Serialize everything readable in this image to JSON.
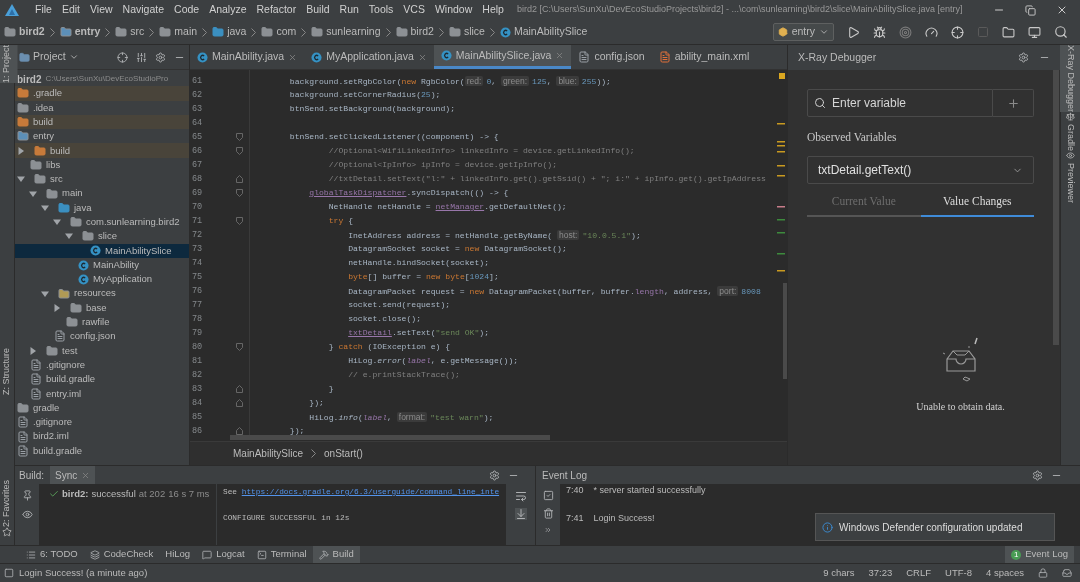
{
  "menu_bar": {
    "items": [
      "File",
      "Edit",
      "View",
      "Navigate",
      "Code",
      "Analyze",
      "Refactor",
      "Build",
      "Run",
      "Tools",
      "VCS",
      "Window",
      "Help"
    ],
    "title": "bird2 [C:\\Users\\SunXu\\DevEcoStudioProjects\\bird2] - ...\\com\\sunlearning\\bird2\\slice\\MainAbilitySlice.java [entry]"
  },
  "breadcrumbs": [
    {
      "label": "bird2",
      "kind": "project"
    },
    {
      "label": "entry",
      "kind": "module"
    },
    {
      "label": "src",
      "kind": "folder"
    },
    {
      "label": "main",
      "kind": "folder"
    },
    {
      "label": "java",
      "kind": "source"
    },
    {
      "label": "com",
      "kind": "folder"
    },
    {
      "label": "sunlearning",
      "kind": "folder"
    },
    {
      "label": "bird2",
      "kind": "folder"
    },
    {
      "label": "slice",
      "kind": "folder"
    },
    {
      "label": "MainAbilitySlice",
      "kind": "class"
    }
  ],
  "run_config": "entry",
  "left_strip": [
    {
      "label": "1: Project",
      "selected": true
    },
    {
      "label": "Z: Structure",
      "selected": false
    }
  ],
  "favorites_strip": {
    "label": "2: Favorites"
  },
  "right_strip": [
    {
      "label": "X-Ray Debugger",
      "selected": true
    },
    {
      "label": "Gradle",
      "selected": false
    },
    {
      "label": "Previewer",
      "selected": false
    }
  ],
  "project_panel": {
    "view": "Project",
    "root": {
      "name": "bird2",
      "path": "C:\\Users\\SunXu\\DevEcoStudioPro"
    },
    "tree": [
      {
        "name": ".gradle",
        "kind": "excluded",
        "selected": false
      },
      {
        "name": ".idea",
        "kind": "folder",
        "selected": false
      },
      {
        "name": "build",
        "kind": "excluded",
        "selected": false
      },
      {
        "name": "entry",
        "kind": "module",
        "selected": false,
        "children": [
          {
            "name": "build",
            "kind": "excluded",
            "expanded": false,
            "selected": false
          },
          {
            "name": "libs",
            "kind": "folder",
            "selected": false
          },
          {
            "name": "src",
            "kind": "folder",
            "expanded": true,
            "selected": false,
            "children": [
              {
                "name": "main",
                "kind": "folder",
                "expanded": true,
                "selected": false,
                "children": [
                  {
                    "name": "java",
                    "kind": "source",
                    "expanded": true,
                    "selected": false,
                    "children": [
                      {
                        "name": "com.sunlearning.bird2",
                        "kind": "package",
                        "expanded": true,
                        "selected": false,
                        "children": [
                          {
                            "name": "slice",
                            "kind": "package",
                            "expanded": true,
                            "selected": false,
                            "children": [
                              {
                                "name": "MainAbilitySlice",
                                "kind": "class",
                                "selected": true
                              }
                            ]
                          },
                          {
                            "name": "MainAbility",
                            "kind": "class",
                            "selected": false
                          },
                          {
                            "name": "MyApplication",
                            "kind": "class",
                            "selected": false
                          }
                        ]
                      }
                    ]
                  },
                  {
                    "name": "resources",
                    "kind": "resources",
                    "expanded": true,
                    "selected": false,
                    "children": [
                      {
                        "name": "base",
                        "kind": "package",
                        "expanded": false,
                        "selected": false
                      },
                      {
                        "name": "rawfile",
                        "kind": "package",
                        "selected": false
                      }
                    ]
                  },
                  {
                    "name": "config.json",
                    "kind": "file",
                    "selected": false
                  }
                ]
              },
              {
                "name": "test",
                "kind": "folder",
                "expanded": false,
                "selected": false
              }
            ]
          },
          {
            "name": ".gitignore",
            "kind": "file",
            "selected": false
          },
          {
            "name": "build.gradle",
            "kind": "file",
            "selected": false
          },
          {
            "name": "entry.iml",
            "kind": "file",
            "selected": false
          }
        ]
      },
      {
        "name": "gradle",
        "kind": "folder",
        "selected": false
      },
      {
        "name": ".gitignore",
        "kind": "file",
        "selected": false
      },
      {
        "name": "bird2.iml",
        "kind": "file",
        "selected": false
      },
      {
        "name": "build.gradle",
        "kind": "file",
        "selected": false
      }
    ]
  },
  "editor_tabs": [
    {
      "label": "MainAbility.java",
      "kind": "class",
      "selected": false,
      "closable": true
    },
    {
      "label": "MyApplication.java",
      "kind": "class",
      "selected": false,
      "closable": true
    },
    {
      "label": "MainAbilitySlice.java",
      "kind": "class",
      "selected": true,
      "closable": true
    },
    {
      "label": "config.json",
      "kind": "json",
      "selected": false,
      "closable": false
    },
    {
      "label": "ability_main.xml",
      "kind": "xml",
      "selected": false,
      "closable": false
    }
  ],
  "code": [
    {
      "number": "61",
      "kind": "plain",
      "segments": [
        {
          "text": "        background.setRgbColor(",
          "kind": "plain"
        },
        {
          "text": "new",
          "kind": "keyword"
        },
        {
          "text": " RgbColor(",
          "kind": "plain"
        },
        {
          "text": "red:",
          "kind": "hint"
        },
        {
          "text": "0",
          "kind": "number"
        },
        {
          "text": ", ",
          "kind": "plain"
        },
        {
          "text": "green:",
          "kind": "hint"
        },
        {
          "text": "125",
          "kind": "number"
        },
        {
          "text": ", ",
          "kind": "plain"
        },
        {
          "text": "blue:",
          "kind": "hint"
        },
        {
          "text": "255",
          "kind": "number"
        },
        {
          "text": "));",
          "kind": "plain"
        }
      ]
    },
    {
      "number": "62",
      "kind": "plain",
      "segments": [
        {
          "text": "        background.setCornerRadius(",
          "kind": "plain"
        },
        {
          "text": "25",
          "kind": "number"
        },
        {
          "text": ");",
          "kind": "plain"
        }
      ]
    },
    {
      "number": "63",
      "kind": "plain",
      "segments": [
        {
          "text": "        btnSend.setBackground(background);",
          "kind": "plain"
        }
      ]
    },
    {
      "number": "64",
      "kind": "plain"
    },
    {
      "number": "65",
      "kind": "fold-start",
      "segments": [
        {
          "text": "        btnSend.setClickedListener((component) -> {",
          "kind": "plain"
        }
      ]
    },
    {
      "number": "66",
      "kind": "fold-start",
      "segments": [
        {
          "text": "                //Optional<WifiLinkedInfo> linkedInfo = device.getLinkedInfo();",
          "kind": "comment"
        }
      ]
    },
    {
      "number": "67",
      "kind": "plain",
      "segments": [
        {
          "text": "                //Optional<IpInfo> ipInfo = device.getIpInfo();",
          "kind": "comment"
        }
      ]
    },
    {
      "number": "68",
      "kind": "fold-end",
      "segments": [
        {
          "text": "                //txtDetail.setText(\"l:\" + linkedInfo.get().getSsid() + \"; i:\" + ipInfo.get().getIpAddress",
          "kind": "comment"
        }
      ]
    },
    {
      "number": "69",
      "kind": "fold-start",
      "segments": [
        {
          "text": "            globalTaskDispatcher",
          "kind": "field"
        },
        {
          "text": ".syncDispatch(() -> {",
          "kind": "plain"
        }
      ]
    },
    {
      "number": "70",
      "kind": "plain",
      "segments": [
        {
          "text": "                NetHandle netHandle = ",
          "kind": "plain"
        },
        {
          "text": "netManager",
          "kind": "field"
        },
        {
          "text": ".getDefaultNet();",
          "kind": "plain"
        }
      ]
    },
    {
      "number": "71",
      "kind": "fold-start",
      "segments": [
        {
          "text": "                try",
          "kind": "keyword"
        },
        {
          "text": " {",
          "kind": "plain"
        }
      ]
    },
    {
      "number": "72",
      "kind": "plain",
      "segments": [
        {
          "text": "                    InetAddress address = netHandle.getByName( ",
          "kind": "plain"
        },
        {
          "text": "host:",
          "kind": "hint"
        },
        {
          "text": "\"10.0.5.1\"",
          "kind": "string"
        },
        {
          "text": ");",
          "kind": "plain"
        }
      ]
    },
    {
      "number": "73",
      "kind": "plain",
      "segments": [
        {
          "text": "                    DatagramSocket socket = ",
          "kind": "plain"
        },
        {
          "text": "new",
          "kind": "keyword"
        },
        {
          "text": " DatagramSocket();",
          "kind": "plain"
        }
      ]
    },
    {
      "number": "74",
      "kind": "plain",
      "segments": [
        {
          "text": "                    netHandle.bindSocket(socket);",
          "kind": "plain"
        }
      ]
    },
    {
      "number": "75",
      "kind": "plain",
      "segments": [
        {
          "text": "                    byte",
          "kind": "keyword"
        },
        {
          "text": "[] buffer = ",
          "kind": "plain"
        },
        {
          "text": "new byte",
          "kind": "keyword"
        },
        {
          "text": "[",
          "kind": "plain"
        },
        {
          "text": "1024",
          "kind": "number"
        },
        {
          "text": "];",
          "kind": "plain"
        }
      ]
    },
    {
      "number": "76",
      "kind": "plain",
      "segments": [
        {
          "text": "                    DatagramPacket request = ",
          "kind": "plain"
        },
        {
          "text": "new",
          "kind": "keyword"
        },
        {
          "text": " DatagramPacket(buffer, buffer.",
          "kind": "plain"
        },
        {
          "text": "length",
          "kind": "property"
        },
        {
          "text": ", address, ",
          "kind": "plain"
        },
        {
          "text": "port:",
          "kind": "hint"
        },
        {
          "text": "8008",
          "kind": "number"
        }
      ]
    },
    {
      "number": "77",
      "kind": "plain",
      "segments": [
        {
          "text": "                    socket.send(request);",
          "kind": "plain"
        }
      ]
    },
    {
      "number": "78",
      "kind": "plain",
      "segments": [
        {
          "text": "                    socket.close();",
          "kind": "plain"
        }
      ]
    },
    {
      "number": "79",
      "kind": "plain",
      "segments": [
        {
          "text": "                    txtDetail",
          "kind": "field"
        },
        {
          "text": ".setText(",
          "kind": "plain"
        },
        {
          "text": "\"send OK\"",
          "kind": "string"
        },
        {
          "text": ");",
          "kind": "plain"
        }
      ]
    },
    {
      "number": "80",
      "kind": "fold-start",
      "segments": [
        {
          "text": "                } ",
          "kind": "plain"
        },
        {
          "text": "catch",
          "kind": "keyword"
        },
        {
          "text": " (IOException e) {",
          "kind": "plain"
        }
      ]
    },
    {
      "number": "81",
      "kind": "plain",
      "segments": [
        {
          "text": "                    HiLog.",
          "kind": "plain"
        },
        {
          "text": "error",
          "kind": "italic"
        },
        {
          "text": "(",
          "kind": "plain"
        },
        {
          "text": "label",
          "kind": "italic-field"
        },
        {
          "text": ", e.getMessage());",
          "kind": "plain"
        }
      ]
    },
    {
      "number": "82",
      "kind": "plain",
      "segments": [
        {
          "text": "                    // e.printStackTrace();",
          "kind": "comment"
        }
      ]
    },
    {
      "number": "83",
      "kind": "fold-end",
      "segments": [
        {
          "text": "                }",
          "kind": "plain"
        }
      ]
    },
    {
      "number": "84",
      "kind": "fold-end",
      "segments": [
        {
          "text": "            });",
          "kind": "plain"
        }
      ]
    },
    {
      "number": "85",
      "kind": "plain",
      "segments": [
        {
          "text": "            HiLog.",
          "kind": "plain"
        },
        {
          "text": "info",
          "kind": "italic"
        },
        {
          "text": "(",
          "kind": "plain"
        },
        {
          "text": "label",
          "kind": "italic-field"
        },
        {
          "text": ", ",
          "kind": "plain"
        },
        {
          "text": "format:",
          "kind": "hint"
        },
        {
          "text": "\"test warn\"",
          "kind": "string"
        },
        {
          "text": ");",
          "kind": "plain"
        }
      ]
    },
    {
      "number": "86",
      "kind": "fold-end",
      "segments": [
        {
          "text": "        });",
          "kind": "plain"
        }
      ]
    }
  ],
  "editor_breadcrumbs": [
    "MainAbilitySlice",
    "onStart()"
  ],
  "xray": {
    "title": "X-Ray Debugger",
    "search": {
      "placeholder": "Enter variable"
    },
    "observed_label": "Observed Variables",
    "observed_value": "txtDetail.getText()",
    "tabs": [
      {
        "label": "Current Value",
        "selected": false
      },
      {
        "label": "Value Changes",
        "selected": true
      }
    ],
    "empty_message": "Unable to obtain data."
  },
  "build": {
    "label": "Build:",
    "tabs": [
      {
        "label": "Sync",
        "selected": true
      }
    ],
    "tree": [
      {
        "name": "bird2:",
        "status": "successful",
        "time": "at 202",
        "duration": "16 s 7 ms"
      }
    ],
    "console": [
      {
        "text": "See ",
        "link": "https://docs.gradle.org/6.3/userguide/command_line_inte"
      },
      {
        "text": "CONFIGURE SUCCESSFUL in 12s"
      }
    ]
  },
  "event_log": {
    "title": "Event Log",
    "entries": [
      {
        "time": "7:40",
        "message": "* server started successfully"
      },
      {
        "time": "7:41",
        "message": "Login Success!"
      }
    ]
  },
  "notification": {
    "message": "Windows Defender configuration updated"
  },
  "tool_tabs": [
    {
      "label": "6: TODO",
      "kind": "todo",
      "selected": false
    },
    {
      "label": "CodeCheck",
      "kind": "check",
      "selected": false
    },
    {
      "label": "HiLog",
      "kind": "none",
      "selected": false
    },
    {
      "label": "Logcat",
      "kind": "logcat",
      "selected": false
    },
    {
      "label": "Terminal",
      "kind": "terminal",
      "selected": false
    },
    {
      "label": "Build",
      "kind": "build",
      "selected": true
    }
  ],
  "event_log_button": {
    "label": "Event Log",
    "badge": "1"
  },
  "status_bar": {
    "message": "Login Success! (a minute ago)",
    "items": [
      "9 chars",
      "37:23",
      "CRLF",
      "UTF-8",
      "4 spaces"
    ]
  }
}
